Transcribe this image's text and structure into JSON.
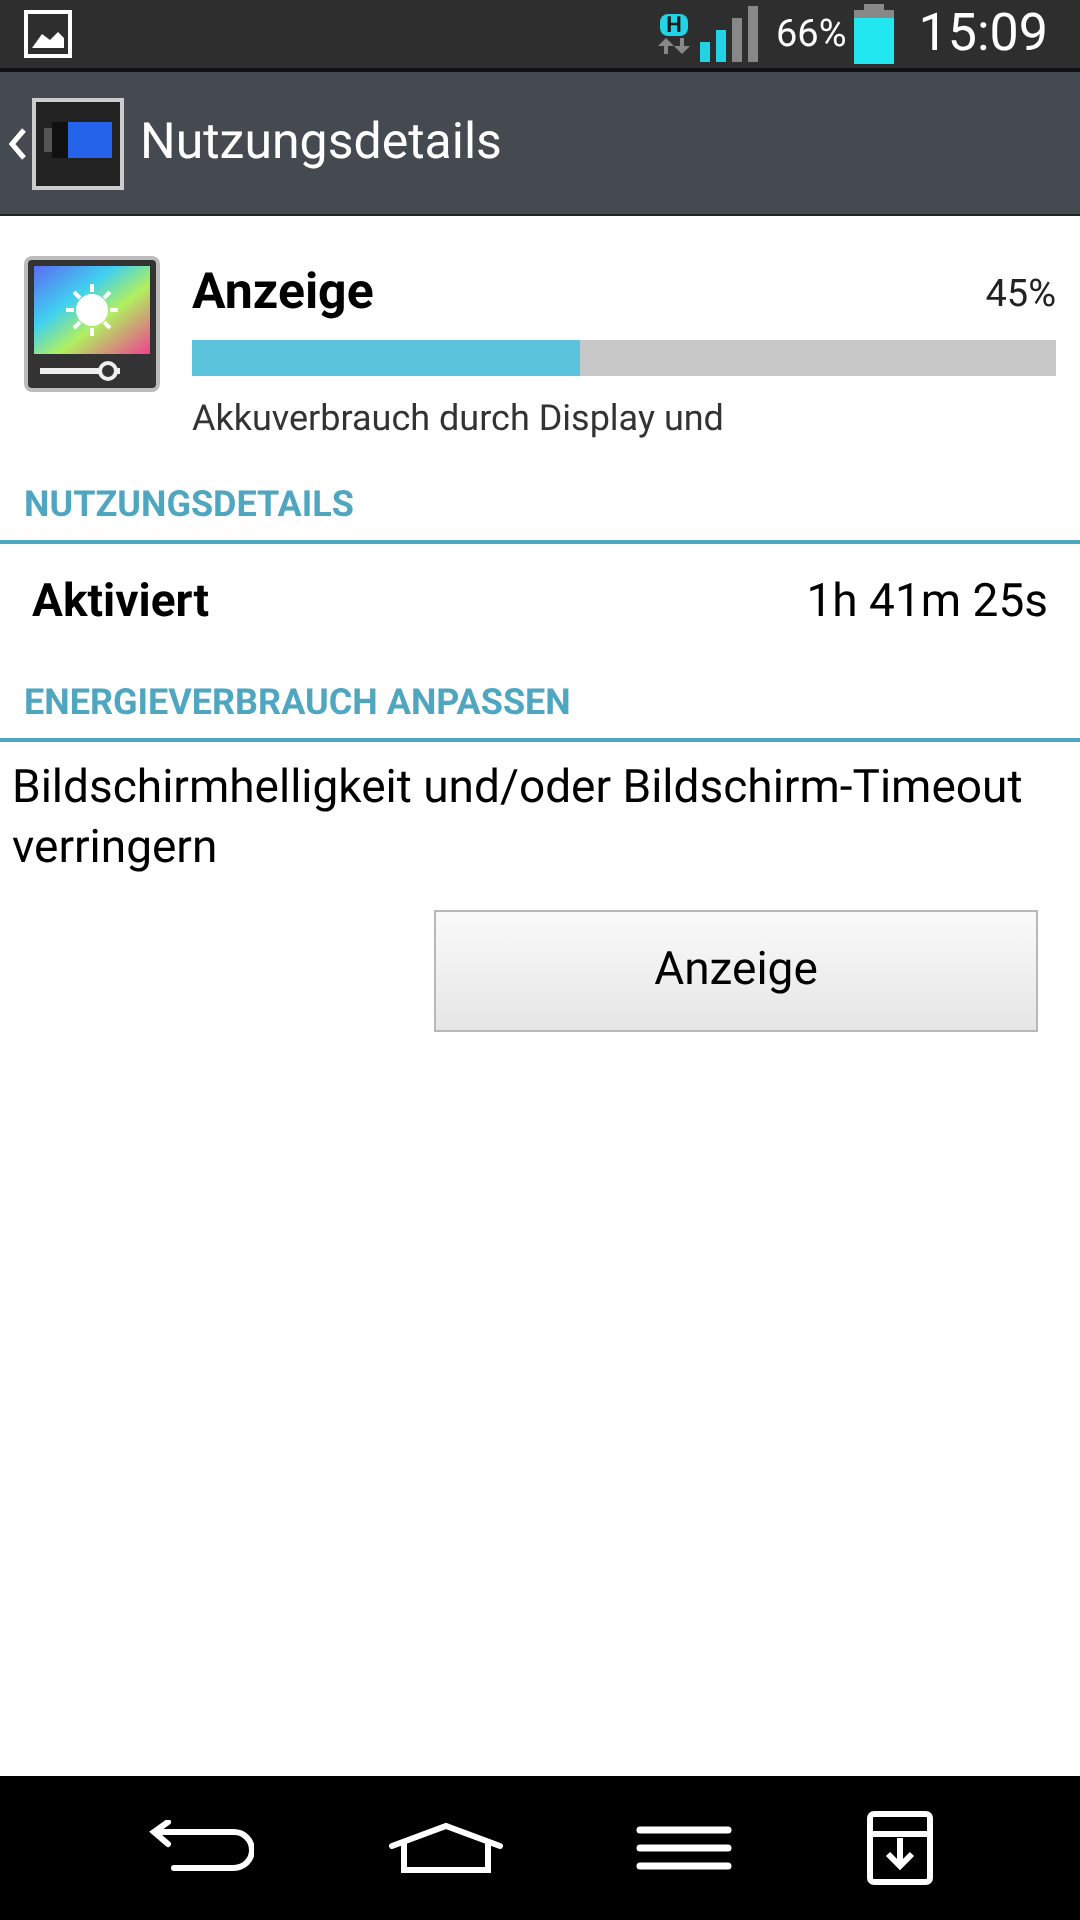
{
  "status_bar": {
    "network": "H",
    "battery": "66%",
    "time": "15:09"
  },
  "action_bar": {
    "title": "Nutzungsdetails"
  },
  "usage_item": {
    "title": "Anzeige",
    "percent": "45%",
    "level": 0.45,
    "description": "Akkuverbrauch durch Display und"
  },
  "sections": [
    {
      "header": "NUTZUNGSDETAILS",
      "rows": [
        {
          "label": "Aktiviert",
          "value": "1h 41m 25s"
        }
      ]
    },
    {
      "header": "ENERGIEVERBRAUCH ANPASSEN",
      "text": "Bildschirmhelligkeit und/oder Bildschirm-Timeout verringern",
      "button": "Anzeige"
    }
  ]
}
